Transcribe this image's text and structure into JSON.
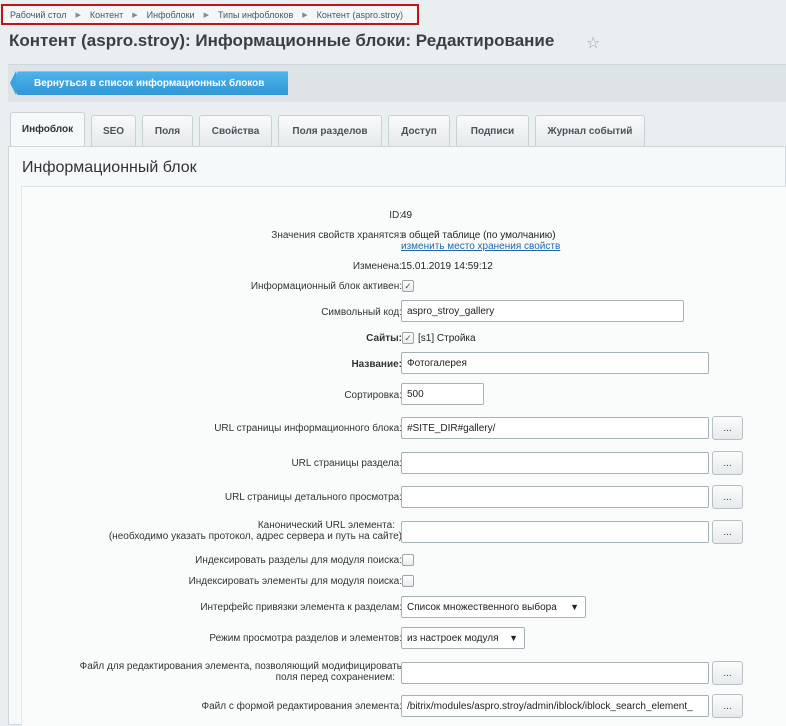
{
  "breadcrumb": {
    "items": [
      "Рабочий стол",
      "Контент",
      "Инфоблоки",
      "Типы инфоблоков",
      "Контент (aspro.stroy)"
    ]
  },
  "page": {
    "title": "Контент (aspro.stroy): Информационные блоки: Редактирование",
    "star_icon": "☆"
  },
  "toolbar": {
    "back_label": "Вернуться в список информационных блоков"
  },
  "tabs": [
    {
      "label": "Инфоблок",
      "active": true
    },
    {
      "label": "SEO",
      "active": false
    },
    {
      "label": "Поля",
      "active": false
    },
    {
      "label": "Свойства",
      "active": false
    },
    {
      "label": "Поля разделов",
      "active": false
    },
    {
      "label": "Доступ",
      "active": false
    },
    {
      "label": "Подписи",
      "active": false
    },
    {
      "label": "Журнал событий",
      "active": false
    }
  ],
  "section": {
    "title": "Информационный блок"
  },
  "form": {
    "id_label": "ID:",
    "id_value": "49",
    "storage_label": "Значения свойств хранятся:",
    "storage_value": "в общей таблице (по умолчанию)",
    "storage_link": "изменить место хранения свойств",
    "modified_label": "Изменена:",
    "modified_value": "15.01.2019 14:59:12",
    "active_label": "Информационный блок активен:",
    "active_checked": true,
    "code_label": "Символьный код:",
    "code_value": "aspro_stroy_gallery",
    "sites_label": "Сайты:",
    "sites_value": "[s1] Стройка",
    "sites_checked": true,
    "name_label": "Название:",
    "name_value": "Фотогалерея",
    "sort_label": "Сортировка:",
    "sort_value": "500",
    "list_url_label": "URL страницы информационного блока:",
    "list_url_value": "#SITE_DIR#gallery/",
    "section_url_label": "URL страницы раздела:",
    "section_url_value": "",
    "detail_url_label": "URL страницы детального просмотра:",
    "detail_url_value": "",
    "canonical_label_1": "Канонический URL элемента:",
    "canonical_label_2": "(необходимо указать протокол, адрес сервера и путь на сайте)",
    "canonical_value": "",
    "index_sections_label": "Индексировать разделы для модуля поиска:",
    "index_sections_checked": false,
    "index_elements_label": "Индексировать элементы для модуля поиска:",
    "index_elements_checked": false,
    "binding_label": "Интерфейс привязки элемента к разделам:",
    "binding_value": "Список множественного выбора",
    "view_mode_label": "Режим просмотра разделов и элементов:",
    "view_mode_value": "из настроек модуля",
    "edit_file_label_1": "Файл для редактирования элемента, позволяющий модифицировать",
    "edit_file_label_2": "поля перед сохранением:",
    "edit_file_value": "",
    "form_file_label": "Файл с формой редактирования элемента:",
    "form_file_value": "/bitrix/modules/aspro.stroy/admin/iblock/iblock_search_element_",
    "dots_label": "...",
    "check_mark": "✓",
    "dropdown_arrow": "▼"
  }
}
